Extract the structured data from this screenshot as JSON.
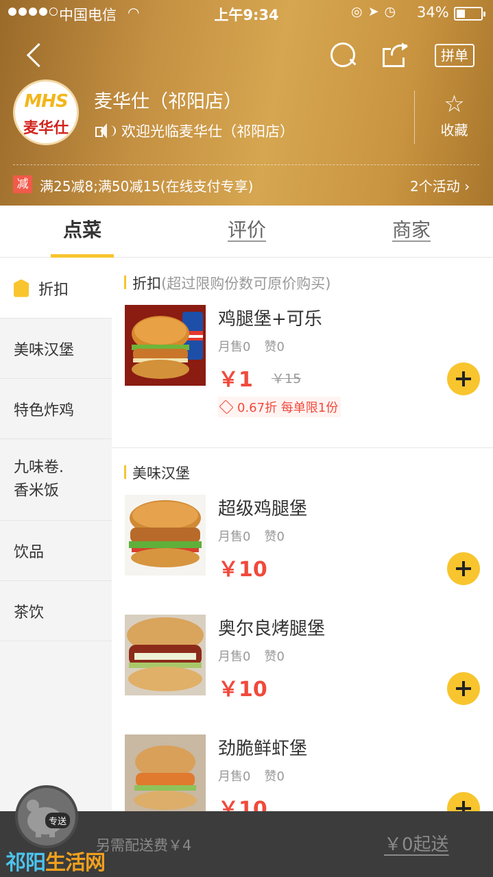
{
  "status_bar": {
    "carrier": "中国电信",
    "time": "上午9:34",
    "battery": "34%",
    "battery_level": 0.34
  },
  "nav": {
    "group_label": "拼单"
  },
  "shop": {
    "name": "麦华仕（祁阳店）",
    "notice": "欢迎光临麦华仕（祁阳店）",
    "logo_top": "MHS",
    "logo_bottom": "麦华仕",
    "fav_label": "收藏"
  },
  "promo": {
    "badge": "减",
    "text": "满25减8;满50减15(在线支付专享)",
    "more": "2个活动"
  },
  "tabs": [
    "点菜",
    "评价",
    "商家"
  ],
  "sidebar": {
    "items": [
      {
        "label": "折扣"
      },
      {
        "label": "美味汉堡"
      },
      {
        "label": "特色炸鸡"
      },
      {
        "label": "九味卷.\n香米饭"
      },
      {
        "label": "饮品"
      },
      {
        "label": "茶饮"
      }
    ]
  },
  "sections": {
    "discount_title": "折扣",
    "discount_sub": "(超过限购份数可原价购买)",
    "burger_title": "美味汉堡"
  },
  "items": [
    {
      "name": "鸡腿堡+可乐",
      "sales": "月售0",
      "likes": "赞0",
      "price": "￥1",
      "original": "￥15",
      "discount": "0.67折 每单限1份"
    },
    {
      "name": "超级鸡腿堡",
      "sales": "月售0",
      "likes": "赞0",
      "price": "￥10"
    },
    {
      "name": "奥尔良烤腿堡",
      "sales": "月售0",
      "likes": "赞0",
      "price": "￥10"
    },
    {
      "name": "劲脆鲜虾堡",
      "sales": "月售0",
      "likes": "赞0",
      "price": "￥10"
    }
  ],
  "cart": {
    "tag": "专送",
    "fee": "另需配送费￥4",
    "min_order": "￥0起送"
  },
  "watermark": {
    "part1": "祁阳",
    "part2": "生活网"
  },
  "colors": {
    "accent": "#f8c52e",
    "price": "#f04a3c",
    "header": "#c49042"
  }
}
